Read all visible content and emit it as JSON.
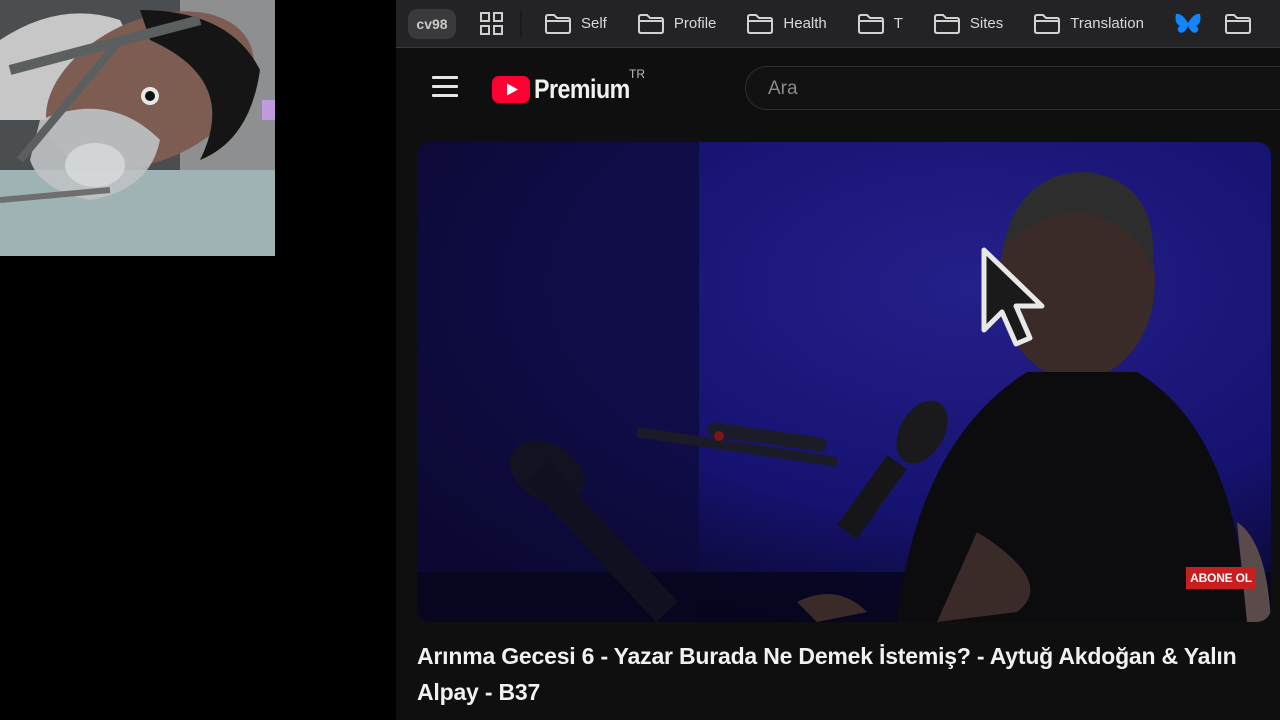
{
  "bookmarks_bar": {
    "profile_label": "cv98",
    "folders": [
      {
        "label": "Self"
      },
      {
        "label": "Profile"
      },
      {
        "label": "Health"
      },
      {
        "label": "T"
      },
      {
        "label": "Sites"
      },
      {
        "label": "Translation"
      }
    ],
    "icons": {
      "apps": "apps-grid-icon",
      "folder": "folder-icon",
      "butterfly": "bluesky-butterfly-icon"
    }
  },
  "youtube": {
    "logo_text": "Premium",
    "logo_country": "TR",
    "search": {
      "placeholder": "Ara",
      "value": ""
    },
    "player": {
      "subscribe_badge": "ABONE OL"
    },
    "video_title": "Arınma Gecesi 6 - Yazar Burada Ne Demek İstemiş? - Aytuğ Akdoğan & Yalın Alpay - B37"
  },
  "colors": {
    "accent_red": "#ff0033",
    "badge_red": "#c71f1f",
    "page_bg": "#0f0f0f",
    "bookmarks_bg": "#232325",
    "butterfly_blue": "#1185fe"
  }
}
